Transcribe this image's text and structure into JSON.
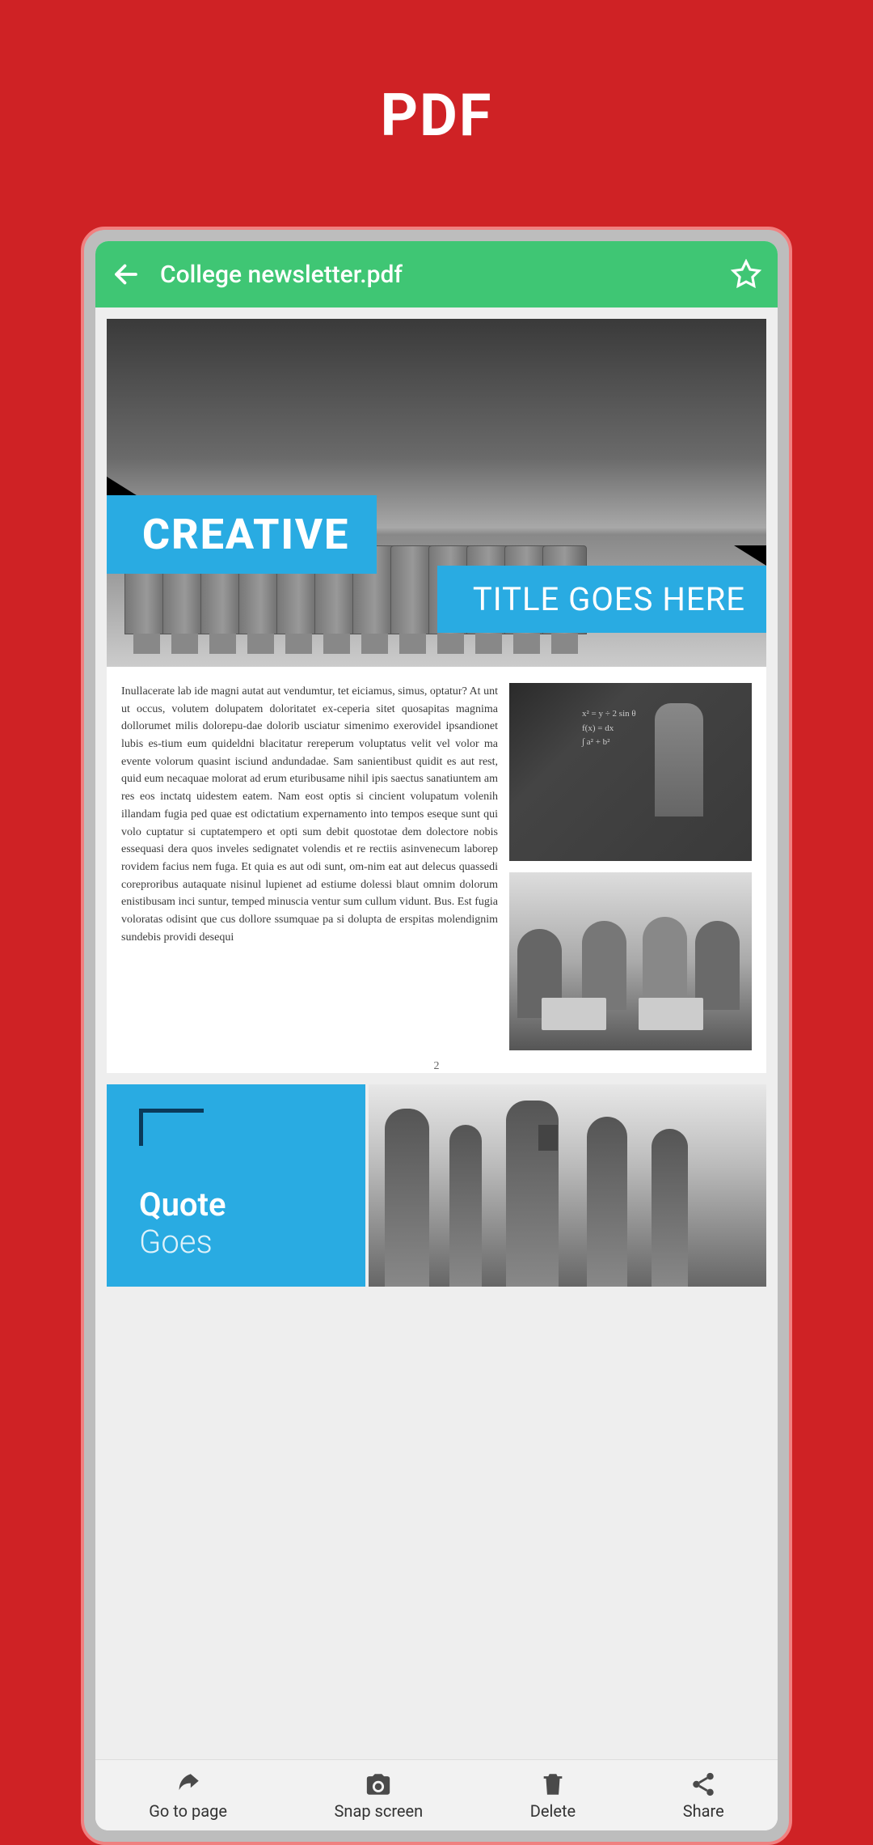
{
  "page_title": "PDF",
  "header": {
    "file_name": "College newsletter.pdf"
  },
  "pdf": {
    "hero_title_1": "CREATIVE",
    "hero_title_2": "TITLE GOES HERE",
    "body_text": "Inullacerate lab ide magni autat aut vendumtur, tet eiciamus, simus, optatur? At unt ut occus, volutem dolupatem doloritatet ex-ceperia sitet quosapitas magnima dollorumet milis dolorepu-dae dolorib usciatur simenimo exerovidel ipsandionet lubis es-tium eum quideldni blacitatur rereperum voluptatus velit vel volor ma evente volorum quasint isciund andundadae. Sam sanientibust quidit es aut rest, quid eum necaquae molorat ad erum eturibusame nihil ipis saectus sanatiuntem am res eos inctatq uidestem eatem. Nam eost optis si cincient volupatum volenih illandam fugia ped quae est odictatium expernamento into tempos eseque sunt qui volo cuptatur si cuptatempero et opti sum debit quostotae dem dolectore nobis essequasi dera quos inveles sedignatet volendis et re rectiis asinvenecum laborep rovidem facius nem fuga. Et quia es aut odi sunt, om-nim eat aut delecus quassedi coreproribus autaquate nisinul lupienet ad estiume dolessi blaut omnim dolorum enistibusam inci suntur, temped minuscia ventur sum cullum vidunt.  Bus. Est fugia voloratas odisint que cus dollore ssumquae pa si dolupta de erspitas molendignim sundebis providi desequi",
    "page_number": "2",
    "quote_line_1": "Quote",
    "quote_line_2": "Goes",
    "formulas_text": "x² = y ÷ 2  sin θ\nf(x) = dx\n∫ a² + b²"
  },
  "toolbar": {
    "goto": "Go to page",
    "snap": "Snap screen",
    "delete": "Delete",
    "share": "Share"
  }
}
